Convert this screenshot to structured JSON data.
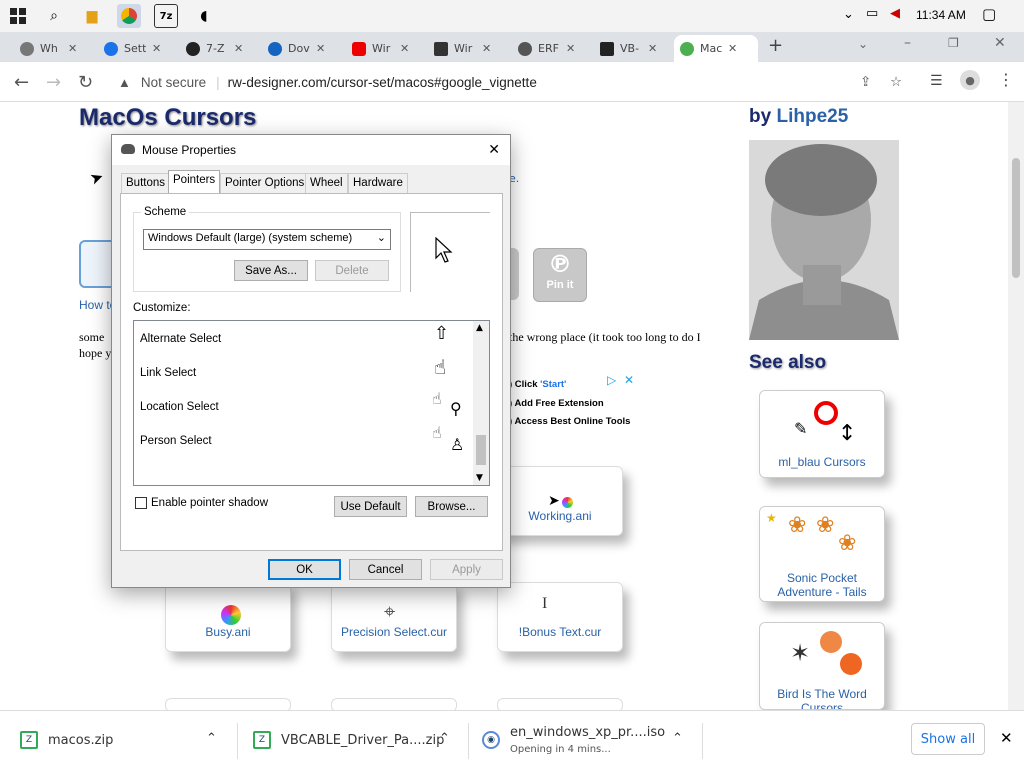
{
  "taskbar": {
    "time": "11:34 AM"
  },
  "tabs": [
    {
      "label": "Wh",
      "color": "#777"
    },
    {
      "label": "Sett",
      "color": "#1a73e8"
    },
    {
      "label": "7-Z",
      "color": "#222"
    },
    {
      "label": "Dov",
      "color": "#1565c0"
    },
    {
      "label": "Wir",
      "color": "#e00"
    },
    {
      "label": "Wir",
      "color": "#333"
    },
    {
      "label": "ERF",
      "color": "#555"
    },
    {
      "label": "VB-",
      "color": "#222"
    },
    {
      "label": "Mac",
      "color": "#4caf50"
    }
  ],
  "address": {
    "security": "Not secure",
    "url": "rw-designer.com/cursor-set/macos#google_vignette"
  },
  "page": {
    "title": "MacOs Cursors",
    "by_prefix": "by",
    "author": "Lihpe25",
    "see_also": "See also",
    "how_to": "How to",
    "text_some": "some",
    "text_hope": "hope y",
    "text_wrong": "the wrong place (it took too long to do I",
    "pin_label": "Pin it",
    "ad_dot": "e.",
    "ad_lines": [
      {
        "prefix": ") Click ",
        "link": "'Start'"
      },
      {
        "prefix": ") Add Free Extension",
        "link": ""
      },
      {
        "prefix": ") Access Best Online Tools",
        "link": ""
      }
    ],
    "cards": [
      {
        "label": "Working.ani"
      },
      {
        "label": "Busy.ani"
      },
      {
        "label": "Precision Select.cur"
      },
      {
        "label": "!Bonus Text.cur"
      }
    ],
    "side_cards": [
      {
        "label": "ml_blau Cursors"
      },
      {
        "label_1": "Sonic Pocket",
        "label_2": "Adventure - Tails"
      },
      {
        "label_1": "Bird Is The Word",
        "label_2": "Cursors"
      }
    ]
  },
  "dialog": {
    "title": "Mouse Properties",
    "tabs": [
      "Buttons",
      "Pointers",
      "Pointer Options",
      "Wheel",
      "Hardware"
    ],
    "scheme_label": "Scheme",
    "scheme_value": "Windows Default (large) (system scheme)",
    "save_as": "Save As...",
    "delete": "Delete",
    "customize_label": "Customize:",
    "rows": [
      "Alternate Select",
      "Link Select",
      "Location Select",
      "Person Select"
    ],
    "shadow_label": "Enable pointer shadow",
    "use_default": "Use Default",
    "browse": "Browse...",
    "ok": "OK",
    "cancel": "Cancel",
    "apply": "Apply"
  },
  "downloads": [
    {
      "name": "macos.zip",
      "status": ""
    },
    {
      "name": "VBCABLE_Driver_Pa....zip",
      "status": ""
    },
    {
      "name": "en_windows_xp_pr....iso",
      "status": "Opening in 4 mins..."
    }
  ],
  "show_all": "Show all"
}
